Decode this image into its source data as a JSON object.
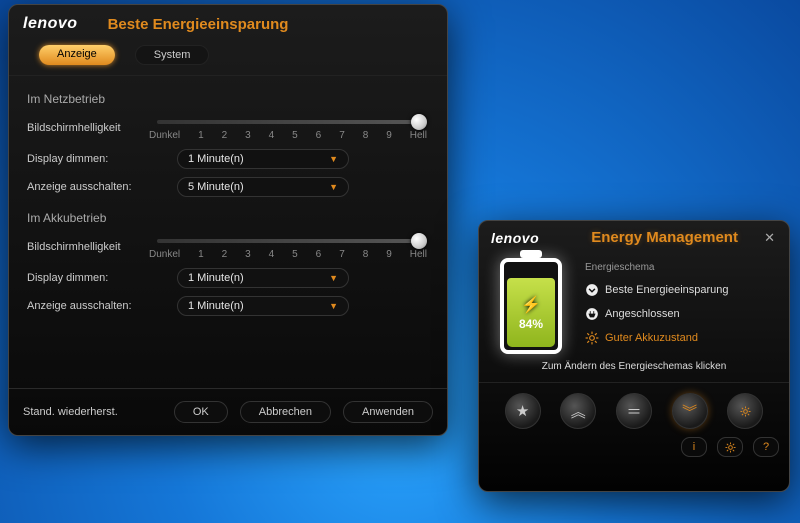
{
  "settings": {
    "brand": "lenovo",
    "title": "Beste Energieeinsparung",
    "tabs": {
      "display": "Anzeige",
      "system": "System"
    },
    "plugged": {
      "title": "Im Netzbetrieb",
      "brightness_label": "Bildschirmhelligkeit",
      "dim_label": "Display dimmen:",
      "off_label": "Anzeige ausschalten:",
      "dim_value": "1 Minute(n)",
      "off_value": "5 Minute(n)"
    },
    "battery": {
      "title": "Im Akkubetrieb",
      "brightness_label": "Bildschirmhelligkeit",
      "dim_label": "Display dimmen:",
      "off_label": "Anzeige ausschalten:",
      "dim_value": "1 Minute(n)",
      "off_value": "1 Minute(n)"
    },
    "slider_ticks": [
      "Dunkel",
      "1",
      "2",
      "3",
      "4",
      "5",
      "6",
      "7",
      "8",
      "9",
      "Hell"
    ],
    "footer": {
      "restore": "Stand. wiederherst.",
      "ok": "OK",
      "cancel": "Abbrechen",
      "apply": "Anwenden"
    }
  },
  "widget": {
    "brand": "lenovo",
    "title": "Energy Management",
    "scheme_head": "Energieschema",
    "scheme_name": "Beste Energieeinsparung",
    "state_plugged": "Angeschlossen",
    "state_health": "Guter Akkuzustand",
    "percent_text": "84%",
    "percent_value": 84,
    "hint": "Zum Ändern des Energieschemas klicken"
  }
}
